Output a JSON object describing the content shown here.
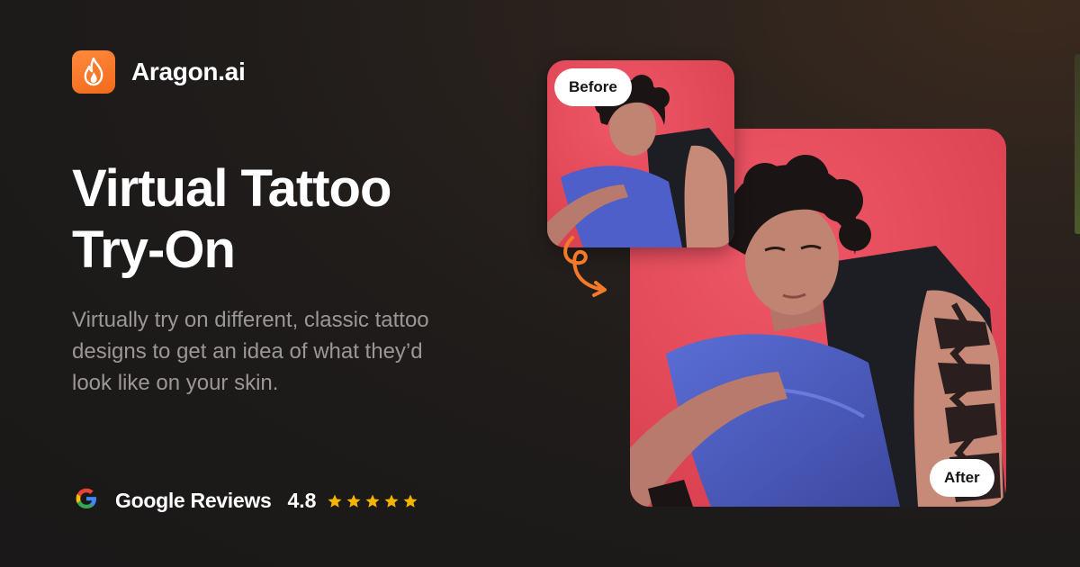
{
  "brand": {
    "name": "Aragon.ai",
    "accent": "#f47a2a"
  },
  "hero": {
    "title_line1": "Virtual Tattoo",
    "title_line2": "Try-On",
    "subtitle": "Virtually try on different, classic tattoo designs to get an idea of what they’d look like on your skin."
  },
  "reviews": {
    "label": "Google Reviews",
    "rating": "4.8",
    "stars": 5,
    "star_color": "#f5b400"
  },
  "images": {
    "before_label": "Before",
    "after_label": "After",
    "background_color": "#e84a5f"
  },
  "icons": [
    "flame-logo-icon",
    "google-icon",
    "star-icon",
    "curved-arrow-icon"
  ]
}
